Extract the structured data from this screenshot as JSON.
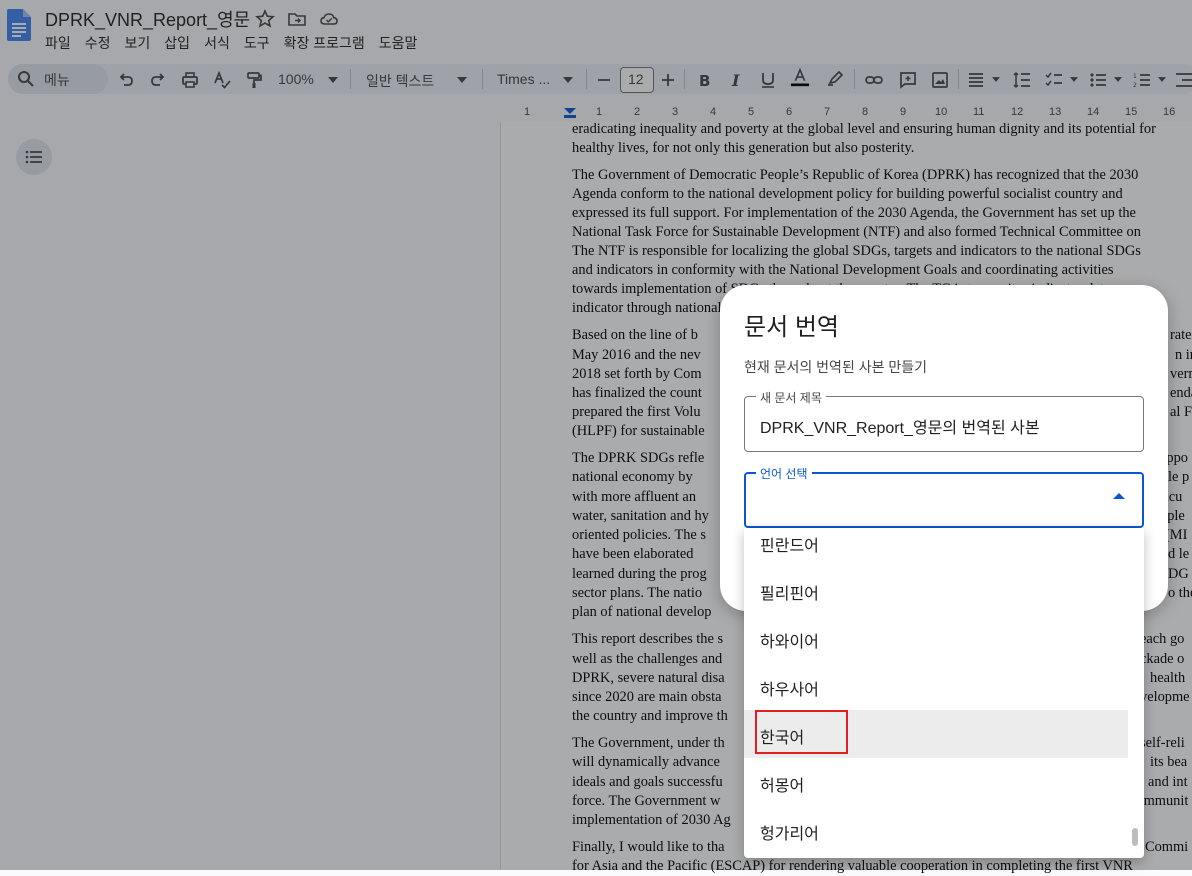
{
  "header": {
    "title": "DPRK_VNR_Report_영문",
    "menu": [
      "파일",
      "수정",
      "보기",
      "삽입",
      "서식",
      "도구",
      "확장 프로그램",
      "도움말"
    ]
  },
  "toolbar": {
    "search_label": "메뉴",
    "zoom": "100%",
    "style": "일반 텍스트",
    "font": "Times ...",
    "font_size": "12"
  },
  "ruler": {
    "numbers": [
      "1",
      "1",
      "2",
      "3",
      "4",
      "5",
      "6",
      "7",
      "8",
      "9",
      "10",
      "11",
      "12",
      "13",
      "14",
      "15",
      "16"
    ]
  },
  "document": {
    "lines": [
      "eradicating inequality and poverty at the global level and ensuring human dignity and its potential for",
      "healthy lives, for not only this generation but also posterity.",
      "The Government of Democratic People’s Republic of Korea (DPRK) has recognized that the 2030",
      "Agenda conform to the national development policy for building powerful socialist country and",
      "expressed its full support. For implementation of the 2030 Agenda, the Government has set up the",
      "National Task Force for Sustainable Development (NTF) and also formed Technical Committee on",
      "The NTF is responsible for localizing the global SDGs, targets and indicators to the national SDGs",
      "and  indicators in conformity with the National Development Goals and coordinating activities",
      "towards  implementation of SDGs throughout the country. The TC is to monitor indicates data",
      "indicator  through national",
      "Based on the line of b",
      "May 2016 and the nev",
      "2018 set forth by Com",
      "has finalized the count",
      "prepared the first Volu",
      "(HLPF) for sustainable",
      "The DPRK SDGs refle",
      "national economy by",
      "with more affluent an",
      "water, sanitation and hy",
      "oriented policies. The s",
      "have been elaborated",
      "learned during the prog",
      "sector plans. The natio",
      "plan of national develop",
      "This report describes the s",
      "well as the challenges and",
      "DPRK, severe natural disa",
      "since 2020 are main obsta",
      "the country and improve th",
      "The Government, under th",
      "will dynamically advance",
      "ideals and goals successfu",
      "force. The Government w",
      "implementation of 2030 Ag",
      "Finally, I would like to tha",
      "for Asia and the Pacific (ESCAP) for rendering valuable cooperation in completing the first VNR"
    ],
    "right_fragments": [
      "rate",
      "n in",
      "vern",
      "enda",
      "al F",
      "appo",
      "le p",
      "ricu",
      "ople",
      "(MI",
      "d le",
      "DG",
      "o the",
      "each go",
      "ckade o",
      "health",
      "velopme",
      "self-reli",
      "its bea",
      "and int",
      "communit",
      "Commi"
    ]
  },
  "dialog": {
    "title": "문서 번역",
    "subtitle": "현재 문서의 번역된 사본 만들기",
    "title_field_label": "새 문서 제목",
    "title_field_value": "DPRK_VNR_Report_영문의 번역된 사본",
    "lang_field_label": "언어 선택",
    "options": [
      "핀란드어",
      "필리핀어",
      "하와이어",
      "하우사어",
      "한국어",
      "허몽어",
      "헝가리어"
    ],
    "selected_option": "한국어"
  }
}
